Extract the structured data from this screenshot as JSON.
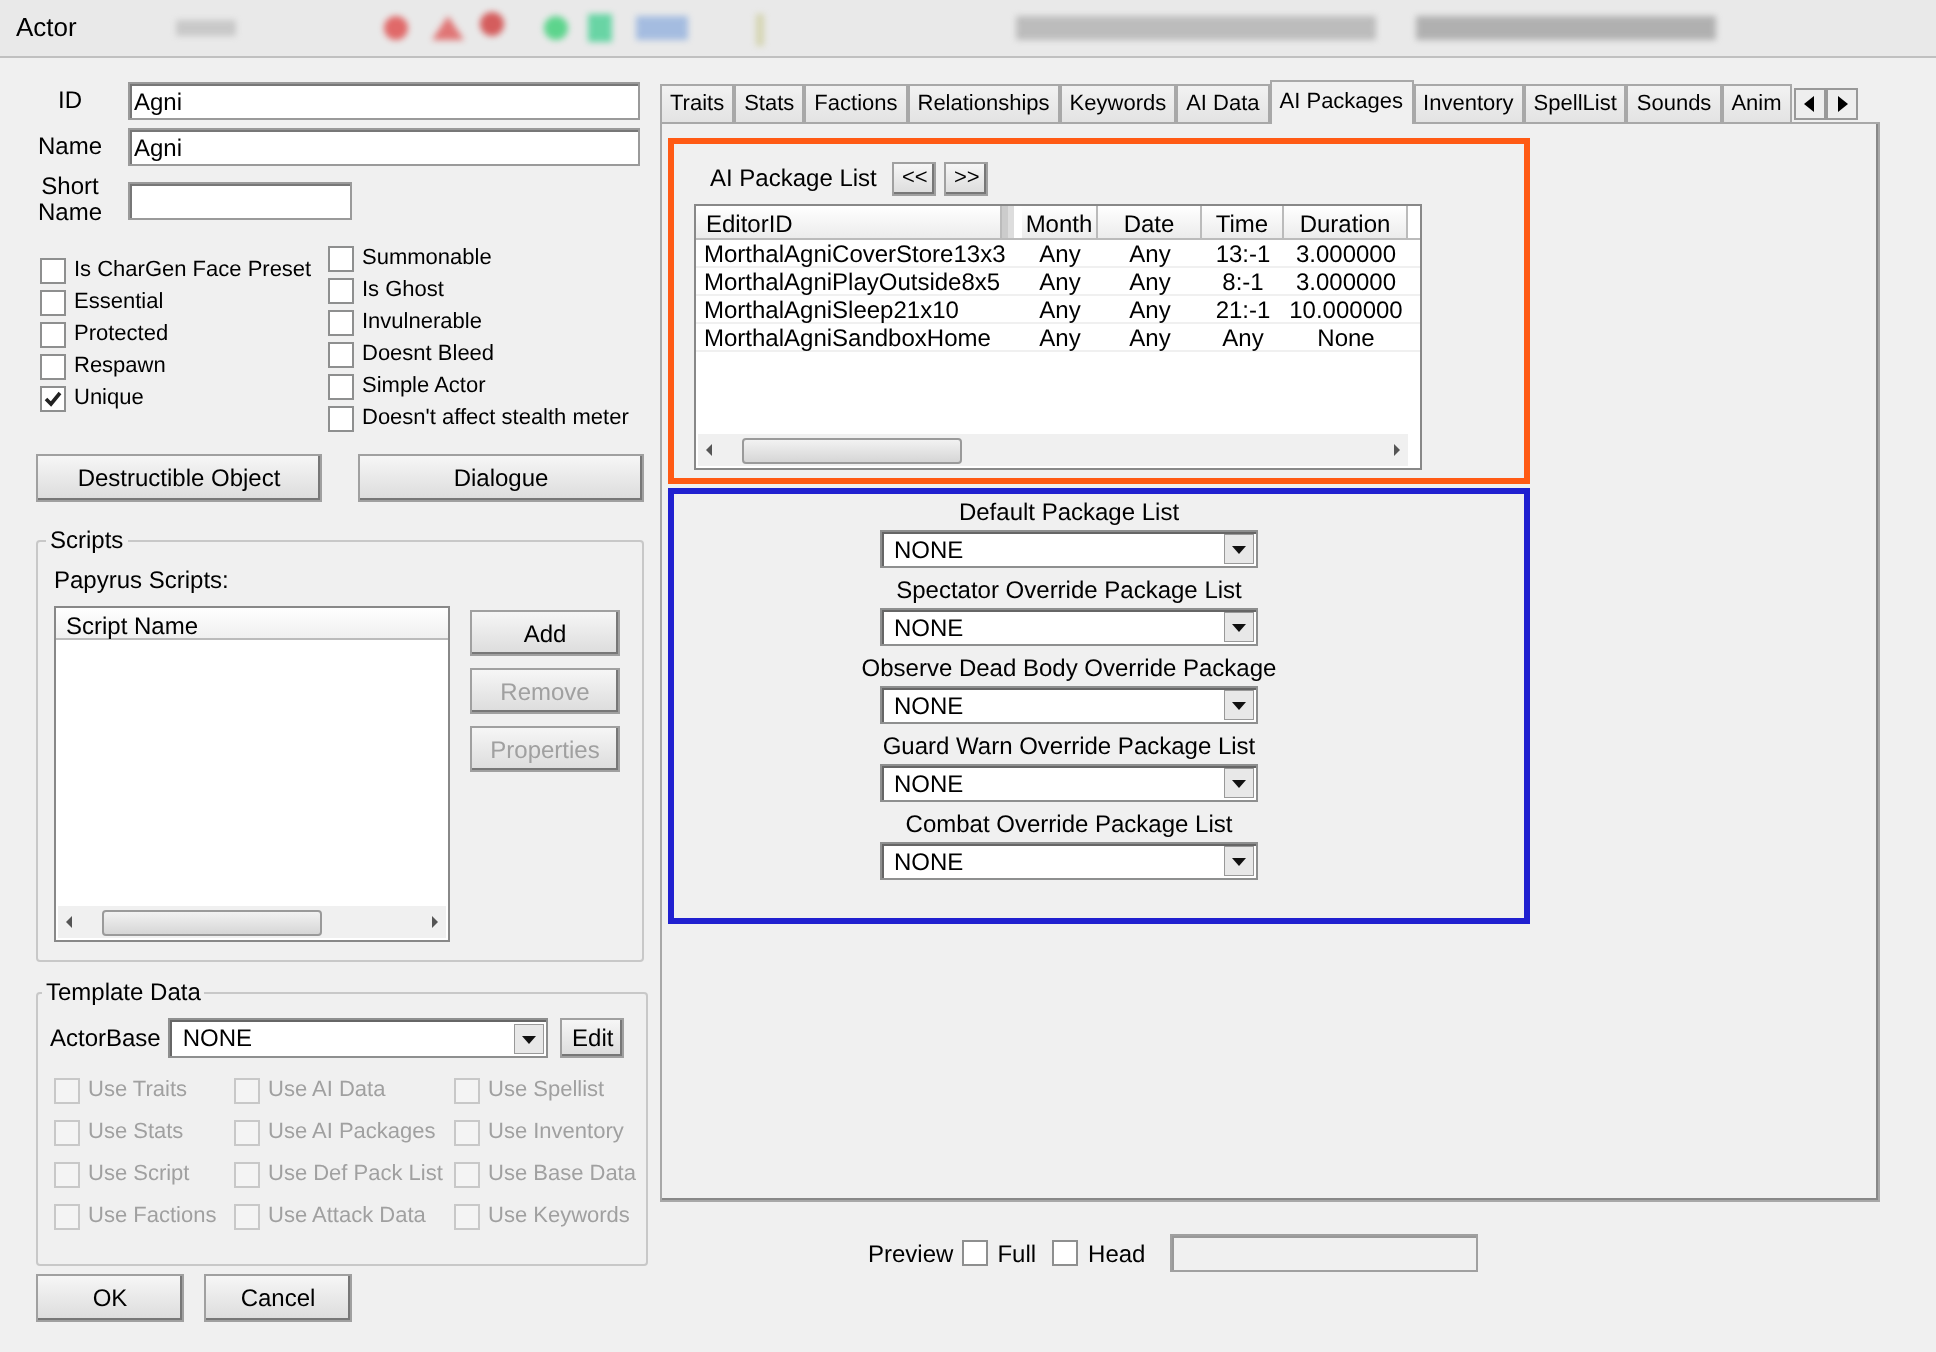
{
  "window": {
    "title": "Actor"
  },
  "fields": [
    {
      "label": "ID",
      "value": "Agni"
    },
    {
      "label": "Name",
      "value": "Agni"
    },
    {
      "label": "Short Name"
    }
  ],
  "flags_left": [
    {
      "label": "Is CharGen Face Preset",
      "checked": false
    },
    {
      "label": "Essential",
      "checked": false
    },
    {
      "label": "Protected",
      "checked": false
    },
    {
      "label": "Respawn",
      "checked": false
    },
    {
      "label": "Unique",
      "checked": true
    }
  ],
  "flags_right": [
    {
      "label": "Summonable",
      "checked": false
    },
    {
      "label": "Is Ghost",
      "checked": false
    },
    {
      "label": "Invulnerable",
      "checked": false
    },
    {
      "label": "Doesnt Bleed",
      "checked": false
    },
    {
      "label": "Simple Actor",
      "checked": false
    },
    {
      "label": "Doesn't affect stealth meter",
      "checked": false
    }
  ],
  "record_buttons": [
    "Destructible Object",
    "Dialogue"
  ],
  "scripts": {
    "title": "Scripts",
    "label": "Papyrus Scripts:",
    "column": "Script Name",
    "buttons": [
      {
        "label": "Add",
        "disabled": false
      },
      {
        "label": "Remove",
        "disabled": true
      },
      {
        "label": "Properties",
        "disabled": true
      }
    ]
  },
  "template": {
    "title": "Template Data",
    "label": "ActorBase",
    "value": "NONE",
    "edit": "Edit",
    "options": [
      {
        "label": "Use Traits",
        "checked": false,
        "disabled": true
      },
      {
        "label": "Use AI Data",
        "checked": false,
        "disabled": true
      },
      {
        "label": "Use Spellist",
        "checked": false,
        "disabled": true
      },
      {
        "label": "Use Stats",
        "checked": false,
        "disabled": true
      },
      {
        "label": "Use AI Packages",
        "checked": false,
        "disabled": true
      },
      {
        "label": "Use Inventory",
        "checked": false,
        "disabled": true
      },
      {
        "label": "Use Script",
        "checked": false,
        "disabled": true
      },
      {
        "label": "Use Def Pack List",
        "checked": false,
        "disabled": true
      },
      {
        "label": "Use Base Data",
        "checked": false,
        "disabled": true
      },
      {
        "label": "Use Factions",
        "checked": false,
        "disabled": true
      },
      {
        "label": "Use Attack Data",
        "checked": false,
        "disabled": true
      },
      {
        "label": "Use Keywords",
        "checked": false,
        "disabled": true
      }
    ]
  },
  "dialog_buttons": [
    "OK",
    "Cancel"
  ],
  "tabs": [
    {
      "label": "Traits",
      "selected": false
    },
    {
      "label": "Stats",
      "selected": false
    },
    {
      "label": "Factions",
      "selected": false
    },
    {
      "label": "Relationships",
      "selected": false
    },
    {
      "label": "Keywords",
      "selected": false
    },
    {
      "label": "AI Data",
      "selected": false
    },
    {
      "label": "AI Packages",
      "selected": true
    },
    {
      "label": "Inventory",
      "selected": false
    },
    {
      "label": "SpellList",
      "selected": false
    },
    {
      "label": "Sounds",
      "selected": false
    },
    {
      "label": "Anim",
      "selected": false
    }
  ],
  "package_list": {
    "title": "AI Package List",
    "nav": [
      "<<",
      ">>"
    ],
    "columns": [
      "EditorID",
      "Month",
      "Date",
      "Time",
      "Duration"
    ],
    "rows": [
      [
        "MorthalAgniCoverStore13x3",
        "Any",
        "Any",
        "13:-1",
        "3.000000"
      ],
      [
        "MorthalAgniPlayOutside8x5",
        "Any",
        "Any",
        "8:-1",
        "3.000000"
      ],
      [
        "MorthalAgniSleep21x10",
        "Any",
        "Any",
        "21:-1",
        "10.000000"
      ],
      [
        "MorthalAgniSandboxHome",
        "Any",
        "Any",
        "Any",
        "None"
      ]
    ]
  },
  "override_lists": [
    {
      "label": "Default Package List",
      "value": "NONE"
    },
    {
      "label": "Spectator Override Package List",
      "value": "NONE"
    },
    {
      "label": "Observe Dead Body Override Package",
      "value": "NONE"
    },
    {
      "label": "Guard Warn Override Package List",
      "value": "NONE"
    },
    {
      "label": "Combat Override Package List",
      "value": "NONE"
    }
  ],
  "preview": {
    "label": "Preview",
    "options": [
      {
        "label": "Full",
        "checked": false
      },
      {
        "label": "Head",
        "checked": false
      }
    ]
  }
}
